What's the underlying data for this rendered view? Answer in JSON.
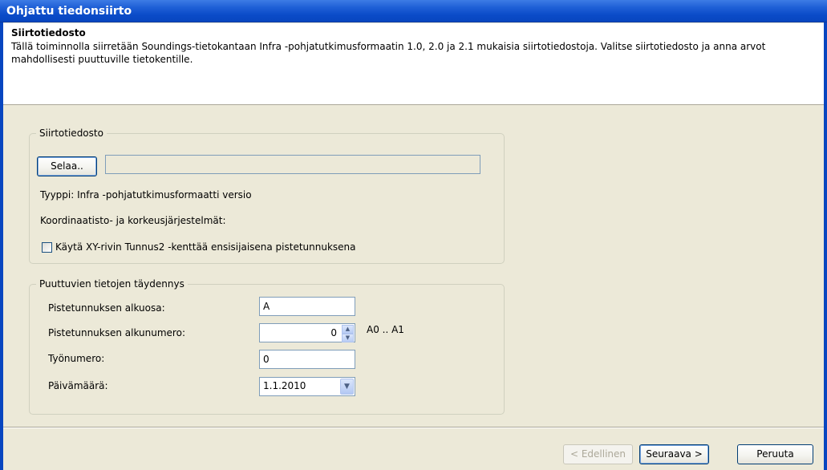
{
  "window": {
    "title": "Ohjattu tiedonsiirto"
  },
  "header": {
    "title": "Siirtotiedosto",
    "description": "Tällä toiminnolla siirretään Soundings-tietokantaan Infra -pohjatutkimusformaatin 1.0, 2.0 ja 2.1 mukaisia siirtotiedostoja. Valitse siirtotiedosto ja anna arvot mahdollisesti puuttuville tietokentille."
  },
  "file_group": {
    "legend": "Siirtotiedosto",
    "browse_label": "Selaa..",
    "file_path": "",
    "type_text": "Tyyppi: Infra -pohjatutkimusformaatti versio",
    "coord_text": "Koordinaatisto- ja korkeusjärjestelmät:",
    "checkbox_label": "Käytä XY-rivin Tunnus2 -kenttää ensisijaisena pistetunnuksena",
    "checkbox_checked": false
  },
  "fill_group": {
    "legend": "Puuttuvien tietojen täydennys",
    "prefix_label": "Pistetunnuksen alkuosa:",
    "prefix_value": "A",
    "start_label": "Pistetunnuksen alkunumero:",
    "start_value": "0",
    "range_text": "A0 .. A1",
    "job_label": "Työnumero:",
    "job_value": "0",
    "date_label": "Päivämäärä:",
    "date_value": "1.1.2010"
  },
  "footer": {
    "back_label": "< Edellinen",
    "next_label": "Seuraava >",
    "cancel_label": "Peruuta"
  },
  "icons": {
    "spin_up": "spin-up-icon",
    "spin_down": "spin-down-icon",
    "dropdown": "chevron-down-icon"
  },
  "colors": {
    "titlebar": "#0a4bc8",
    "panel": "#ece9d8",
    "border": "#7f9db9"
  }
}
